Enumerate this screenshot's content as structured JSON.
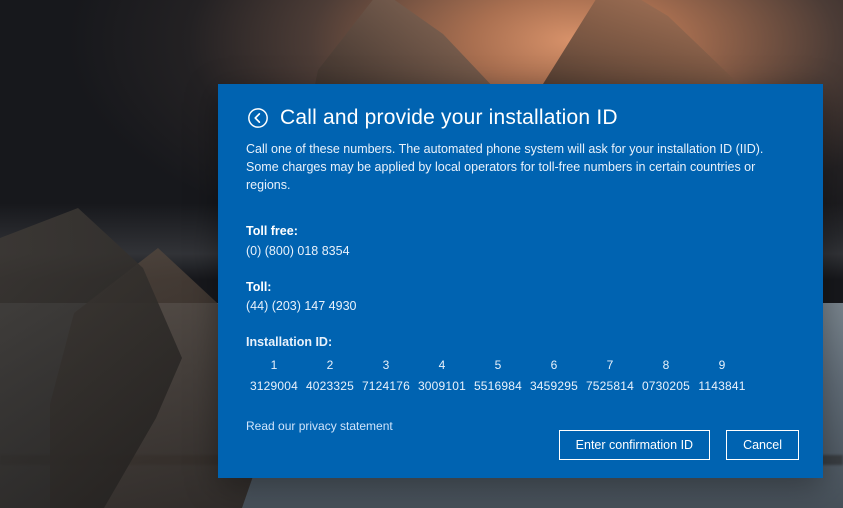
{
  "dialog": {
    "title": "Call and provide your installation ID",
    "instructions": "Call one of these numbers. The automated phone system will ask for your installation ID (IID). Some charges may be applied by local operators for toll-free numbers in certain countries or regions.",
    "toll_free": {
      "label": "Toll free:",
      "number": "(0) (800) 018 8354"
    },
    "toll": {
      "label": "Toll:",
      "number": "(44) (203) 147 4930"
    },
    "installation_id": {
      "label": "Installation ID:",
      "columns": [
        "1",
        "2",
        "3",
        "4",
        "5",
        "6",
        "7",
        "8",
        "9"
      ],
      "values": [
        "3129004",
        "4023325",
        "7124176",
        "3009101",
        "5516984",
        "3459295",
        "7525814",
        "0730205",
        "1143841"
      ]
    },
    "privacy_link": "Read our privacy statement",
    "buttons": {
      "confirm": "Enter confirmation ID",
      "cancel": "Cancel"
    }
  }
}
